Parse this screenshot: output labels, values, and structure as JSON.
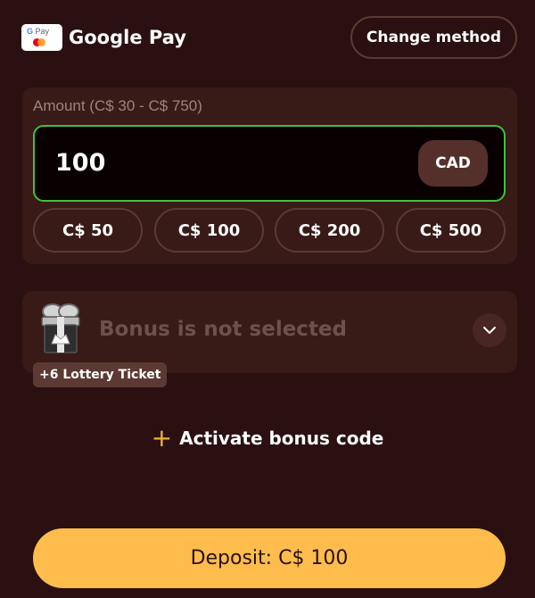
{
  "colors": {
    "background": "#2a1010",
    "card": "#381a17",
    "input_border_active": "#3ec33b",
    "accent_yellow": "#fdbc4b",
    "plus_orange": "#f2b23a",
    "muted_text": "#9d8480"
  },
  "payment_method": {
    "logo_text_g": "G",
    "logo_text_pay": "Pay",
    "name": "Google Pay",
    "change_label": "Change method"
  },
  "amount": {
    "label": "Amount (C$ 30 - C$ 750)",
    "value": "100",
    "currency": "CAD",
    "presets": [
      "C$ 50",
      "C$ 100",
      "C$ 200",
      "C$ 500"
    ]
  },
  "bonus": {
    "icon": "gift-box-icon",
    "status_text": "Bonus is not selected",
    "dropdown_icon": "chevron-down-icon",
    "lottery_badge": "+6 Lottery Ticket"
  },
  "activate_bonus": {
    "plus": "+",
    "label": "Activate bonus code"
  },
  "deposit": {
    "label": "Deposit: C$ 100"
  }
}
